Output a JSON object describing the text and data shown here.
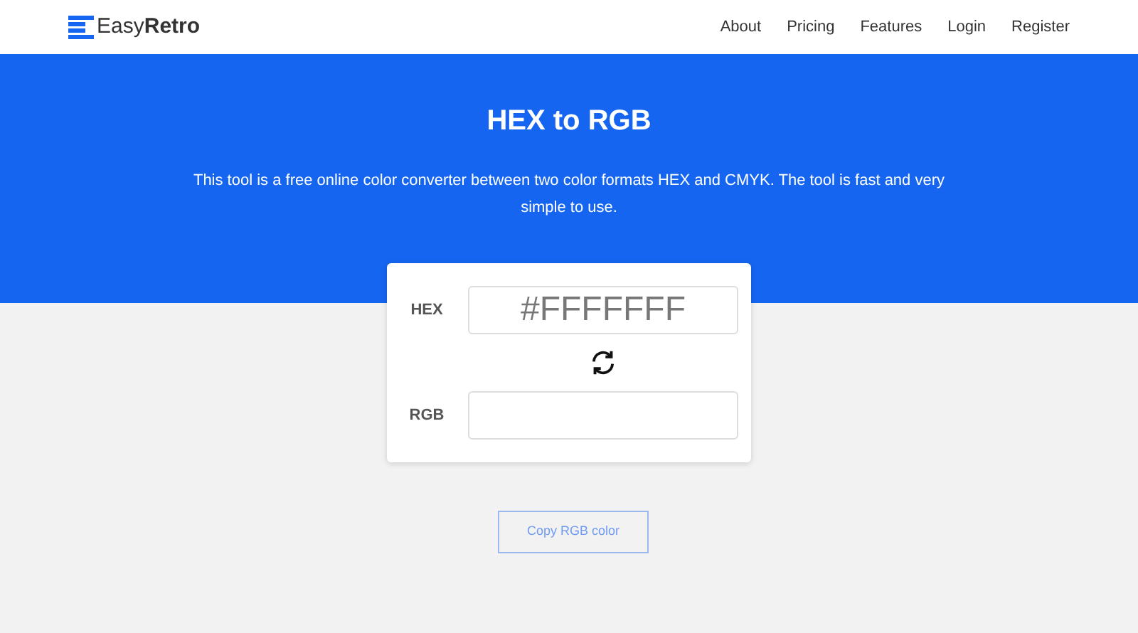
{
  "logo": {
    "word_1": "Easy",
    "word_2": "Retro"
  },
  "nav": [
    {
      "label": "About"
    },
    {
      "label": "Pricing"
    },
    {
      "label": "Features"
    },
    {
      "label": "Login"
    },
    {
      "label": "Register"
    }
  ],
  "hero": {
    "title": "HEX to RGB",
    "description": "This tool is a free online color converter between two color formats HEX and CMYK. The tool is fast and very simple to use."
  },
  "converter": {
    "fields": [
      {
        "label": "HEX",
        "placeholder": "#FFFFFFF"
      },
      {
        "label": "RGB"
      }
    ]
  },
  "copy_button": "Copy RGB color"
}
